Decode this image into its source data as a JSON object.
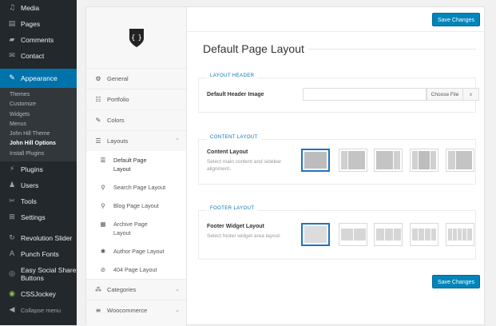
{
  "wp_menu": {
    "items": [
      {
        "icon": "media-icon",
        "glyph": "♫",
        "label": "Media"
      },
      {
        "icon": "pages-icon",
        "glyph": "▤",
        "label": "Pages"
      },
      {
        "icon": "comments-icon",
        "glyph": "▰",
        "label": "Comments"
      },
      {
        "icon": "contact-icon",
        "glyph": "✉",
        "label": "Contact"
      },
      {
        "icon": "appearance-icon",
        "glyph": "✎",
        "label": "Appearance"
      }
    ],
    "submenu": [
      "Themes",
      "Customize",
      "Widgets",
      "Menus",
      "John Hill Theme",
      "John Hill Options",
      "Install Plugins"
    ],
    "items2": [
      {
        "icon": "plugins-icon",
        "glyph": "⚡",
        "label": "Plugins"
      },
      {
        "icon": "users-icon",
        "glyph": "♟",
        "label": "Users"
      },
      {
        "icon": "tools-icon",
        "glyph": "✂",
        "label": "Tools"
      },
      {
        "icon": "settings-icon",
        "glyph": "⊞",
        "label": "Settings"
      }
    ],
    "items3": [
      {
        "icon": "revolution-slider-icon",
        "glyph": "↻",
        "label": "Revolution Slider"
      },
      {
        "icon": "punch-fonts-icon",
        "glyph": "A",
        "label": "Punch Fonts"
      },
      {
        "icon": "easy-social-share-icon",
        "glyph": "◎",
        "label": "Easy Social Share Buttons"
      },
      {
        "icon": "cssjockey-icon",
        "glyph": "◉",
        "label": "CSSJockey"
      },
      {
        "icon": "collapse-menu-icon",
        "glyph": "◀",
        "label": "Collapse menu"
      }
    ]
  },
  "options_nav": {
    "items": [
      {
        "icon": "general-icon",
        "glyph": "⚙",
        "label": "General"
      },
      {
        "icon": "portfolio-icon",
        "glyph": "☷",
        "label": "Portfolio"
      },
      {
        "icon": "colors-icon",
        "glyph": "✎",
        "label": "Colors"
      },
      {
        "icon": "layouts-icon",
        "glyph": "☰",
        "label": "Layouts"
      }
    ],
    "layout_subitems": [
      {
        "icon": "page-layout-icon",
        "glyph": "☰",
        "label": "Default Page Layout"
      },
      {
        "icon": "search-icon",
        "glyph": "⚲",
        "label": "Search Page Layout"
      },
      {
        "icon": "pin-icon",
        "glyph": "⚲",
        "label": "Blog Page Layout"
      },
      {
        "icon": "archive-icon",
        "glyph": "▦",
        "label": "Archive Page Layout"
      },
      {
        "icon": "author-icon",
        "glyph": "✱",
        "label": "Author Page Layout"
      },
      {
        "icon": "not-found-icon",
        "glyph": "⊘",
        "label": "404 Page Layout"
      }
    ],
    "bottom_items": [
      {
        "icon": "categories-icon",
        "glyph": "⁂",
        "label": "Categories"
      },
      {
        "icon": "woocommerce-icon",
        "glyph": "≡",
        "label": "Woocommerce"
      }
    ]
  },
  "main": {
    "save_label": "Save Changes",
    "page_title": "Default Page Layout",
    "header_section": {
      "title": "LAYOUT HEADER",
      "field_label": "Default Header Image",
      "choose_label": "Choose File",
      "clear_label": "x"
    },
    "content_section": {
      "title": "CONTENT LAYOUT",
      "field_label": "Content Layout",
      "field_desc": "Select main content and sidebar alignment."
    },
    "footer_section": {
      "title": "FOOTER LAYOUT",
      "field_label": "Footer Widget Layout",
      "field_desc": "Select footer widget area layout."
    }
  },
  "colors": {
    "accent": "#0073aa",
    "button": "#0085ba",
    "menu_bg": "#23282d",
    "selected_border": "#1e73be"
  }
}
